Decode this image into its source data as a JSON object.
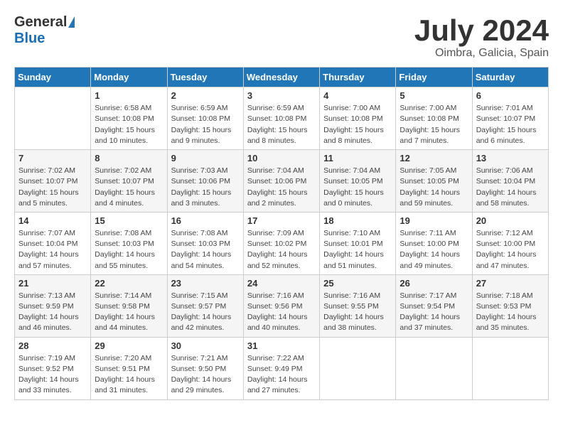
{
  "header": {
    "logo_general": "General",
    "logo_blue": "Blue",
    "month_title": "July 2024",
    "location": "Oimbra, Galicia, Spain"
  },
  "days_of_week": [
    "Sunday",
    "Monday",
    "Tuesday",
    "Wednesday",
    "Thursday",
    "Friday",
    "Saturday"
  ],
  "weeks": [
    [
      {
        "day": "",
        "info": ""
      },
      {
        "day": "1",
        "info": "Sunrise: 6:58 AM\nSunset: 10:08 PM\nDaylight: 15 hours\nand 10 minutes."
      },
      {
        "day": "2",
        "info": "Sunrise: 6:59 AM\nSunset: 10:08 PM\nDaylight: 15 hours\nand 9 minutes."
      },
      {
        "day": "3",
        "info": "Sunrise: 6:59 AM\nSunset: 10:08 PM\nDaylight: 15 hours\nand 8 minutes."
      },
      {
        "day": "4",
        "info": "Sunrise: 7:00 AM\nSunset: 10:08 PM\nDaylight: 15 hours\nand 8 minutes."
      },
      {
        "day": "5",
        "info": "Sunrise: 7:00 AM\nSunset: 10:08 PM\nDaylight: 15 hours\nand 7 minutes."
      },
      {
        "day": "6",
        "info": "Sunrise: 7:01 AM\nSunset: 10:07 PM\nDaylight: 15 hours\nand 6 minutes."
      }
    ],
    [
      {
        "day": "7",
        "info": "Sunrise: 7:02 AM\nSunset: 10:07 PM\nDaylight: 15 hours\nand 5 minutes."
      },
      {
        "day": "8",
        "info": "Sunrise: 7:02 AM\nSunset: 10:07 PM\nDaylight: 15 hours\nand 4 minutes."
      },
      {
        "day": "9",
        "info": "Sunrise: 7:03 AM\nSunset: 10:06 PM\nDaylight: 15 hours\nand 3 minutes."
      },
      {
        "day": "10",
        "info": "Sunrise: 7:04 AM\nSunset: 10:06 PM\nDaylight: 15 hours\nand 2 minutes."
      },
      {
        "day": "11",
        "info": "Sunrise: 7:04 AM\nSunset: 10:05 PM\nDaylight: 15 hours\nand 0 minutes."
      },
      {
        "day": "12",
        "info": "Sunrise: 7:05 AM\nSunset: 10:05 PM\nDaylight: 14 hours\nand 59 minutes."
      },
      {
        "day": "13",
        "info": "Sunrise: 7:06 AM\nSunset: 10:04 PM\nDaylight: 14 hours\nand 58 minutes."
      }
    ],
    [
      {
        "day": "14",
        "info": "Sunrise: 7:07 AM\nSunset: 10:04 PM\nDaylight: 14 hours\nand 57 minutes."
      },
      {
        "day": "15",
        "info": "Sunrise: 7:08 AM\nSunset: 10:03 PM\nDaylight: 14 hours\nand 55 minutes."
      },
      {
        "day": "16",
        "info": "Sunrise: 7:08 AM\nSunset: 10:03 PM\nDaylight: 14 hours\nand 54 minutes."
      },
      {
        "day": "17",
        "info": "Sunrise: 7:09 AM\nSunset: 10:02 PM\nDaylight: 14 hours\nand 52 minutes."
      },
      {
        "day": "18",
        "info": "Sunrise: 7:10 AM\nSunset: 10:01 PM\nDaylight: 14 hours\nand 51 minutes."
      },
      {
        "day": "19",
        "info": "Sunrise: 7:11 AM\nSunset: 10:00 PM\nDaylight: 14 hours\nand 49 minutes."
      },
      {
        "day": "20",
        "info": "Sunrise: 7:12 AM\nSunset: 10:00 PM\nDaylight: 14 hours\nand 47 minutes."
      }
    ],
    [
      {
        "day": "21",
        "info": "Sunrise: 7:13 AM\nSunset: 9:59 PM\nDaylight: 14 hours\nand 46 minutes."
      },
      {
        "day": "22",
        "info": "Sunrise: 7:14 AM\nSunset: 9:58 PM\nDaylight: 14 hours\nand 44 minutes."
      },
      {
        "day": "23",
        "info": "Sunrise: 7:15 AM\nSunset: 9:57 PM\nDaylight: 14 hours\nand 42 minutes."
      },
      {
        "day": "24",
        "info": "Sunrise: 7:16 AM\nSunset: 9:56 PM\nDaylight: 14 hours\nand 40 minutes."
      },
      {
        "day": "25",
        "info": "Sunrise: 7:16 AM\nSunset: 9:55 PM\nDaylight: 14 hours\nand 38 minutes."
      },
      {
        "day": "26",
        "info": "Sunrise: 7:17 AM\nSunset: 9:54 PM\nDaylight: 14 hours\nand 37 minutes."
      },
      {
        "day": "27",
        "info": "Sunrise: 7:18 AM\nSunset: 9:53 PM\nDaylight: 14 hours\nand 35 minutes."
      }
    ],
    [
      {
        "day": "28",
        "info": "Sunrise: 7:19 AM\nSunset: 9:52 PM\nDaylight: 14 hours\nand 33 minutes."
      },
      {
        "day": "29",
        "info": "Sunrise: 7:20 AM\nSunset: 9:51 PM\nDaylight: 14 hours\nand 31 minutes."
      },
      {
        "day": "30",
        "info": "Sunrise: 7:21 AM\nSunset: 9:50 PM\nDaylight: 14 hours\nand 29 minutes."
      },
      {
        "day": "31",
        "info": "Sunrise: 7:22 AM\nSunset: 9:49 PM\nDaylight: 14 hours\nand 27 minutes."
      },
      {
        "day": "",
        "info": ""
      },
      {
        "day": "",
        "info": ""
      },
      {
        "day": "",
        "info": ""
      }
    ]
  ]
}
